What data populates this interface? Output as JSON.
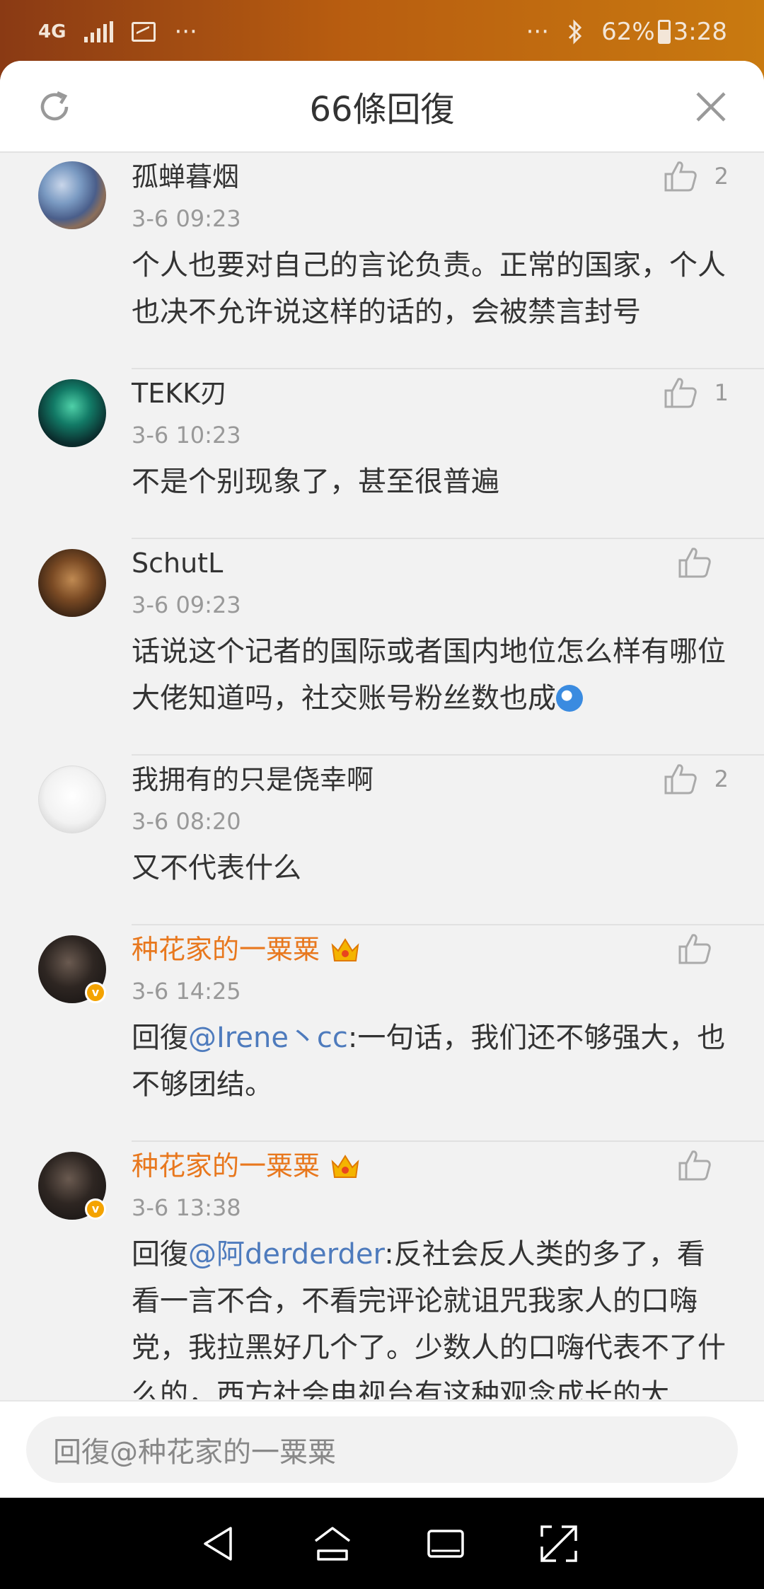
{
  "status_bar": {
    "network": "4G",
    "dots_left": "···",
    "dots_right": "···",
    "battery": "62%",
    "time": "3:28"
  },
  "header": {
    "title": "66條回復"
  },
  "comments": [
    {
      "name": "孤蝉暮烟",
      "time": "3-6 09:23",
      "likes": "2",
      "text": "个人也要对自己的言论负责。正常的国家，个人也决不允许说这样的话的，会被禁言封号"
    },
    {
      "name": "TEKK刃",
      "time": "3-6 10:23",
      "likes": "1",
      "text": "不是个别现象了，甚至很普遍"
    },
    {
      "name": "SchutL",
      "time": "3-6 09:23",
      "likes": "",
      "text": "话说这个记者的国际或者国内地位怎么样有哪位大佬知道吗，社交账号粉丝数也成"
    },
    {
      "name": "我拥有的只是侥幸啊",
      "time": "3-6 08:20",
      "likes": "2",
      "text": "又不代表什么"
    },
    {
      "name": "种花家的一粟粟",
      "time": "3-6 14:25",
      "likes": "",
      "reply_prefix": "回復",
      "mention": "@Irene丶cc",
      "text": ":一句话，我们还不够强大，也不够团结。"
    },
    {
      "name": "种花家的一粟粟",
      "time": "3-6 13:38",
      "likes": "",
      "reply_prefix": "回復",
      "mention": "@阿derderder",
      "text": ":反社会反人类的多了，看看一言不合，不看完评论就诅咒我家人的口嗨党，我拉黑好几个了。少数人的口嗨代表不了什么的，西方社会电视台有这种观念成长的大"
    }
  ],
  "reply_bar": {
    "placeholder": "回復@种花家的一粟粟"
  },
  "colors": {
    "vip_name": "#e8781e",
    "mention": "#4e7bbd",
    "verified_badge": "#f4a300"
  }
}
